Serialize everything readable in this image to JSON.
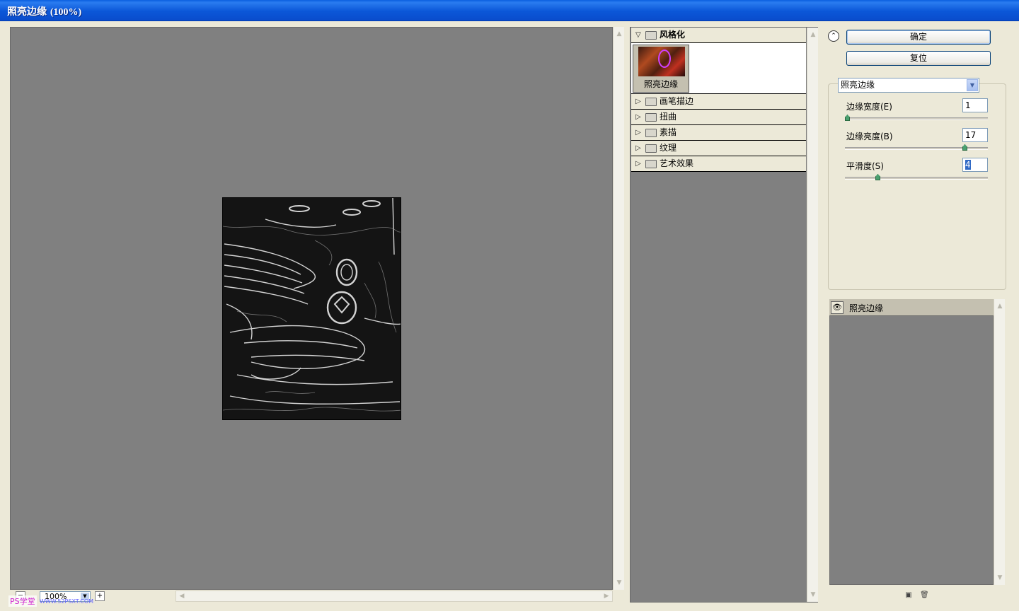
{
  "window": {
    "title": "照亮边缘",
    "title_pct": "(100%)"
  },
  "preview": {
    "zoom_value": "100%",
    "zoom_minus": "−",
    "zoom_plus": "+",
    "watermark": "PS学堂",
    "watermark_site": "WWW.52PSXT.COM"
  },
  "gallery": {
    "open_category": "风格化",
    "open_filter_label": "照亮边缘",
    "categories": [
      "画笔描边",
      "扭曲",
      "素描",
      "纹理",
      "艺术效果"
    ]
  },
  "buttons": {
    "ok_label": "确定",
    "reset_label": "复位",
    "collapse_symbol": "⌃"
  },
  "settings": {
    "filter_select": "照亮边缘",
    "params": [
      {
        "label": "边缘宽度(E)",
        "value": "1",
        "fraction": 0.0
      },
      {
        "label": "边缘亮度(B)",
        "value": "17",
        "fraction": 0.85
      },
      {
        "label": "平滑度(S)",
        "value": "4",
        "fraction": 0.22
      }
    ]
  },
  "layers": {
    "items": [
      {
        "name": "照亮边缘",
        "visible": true
      }
    ]
  }
}
